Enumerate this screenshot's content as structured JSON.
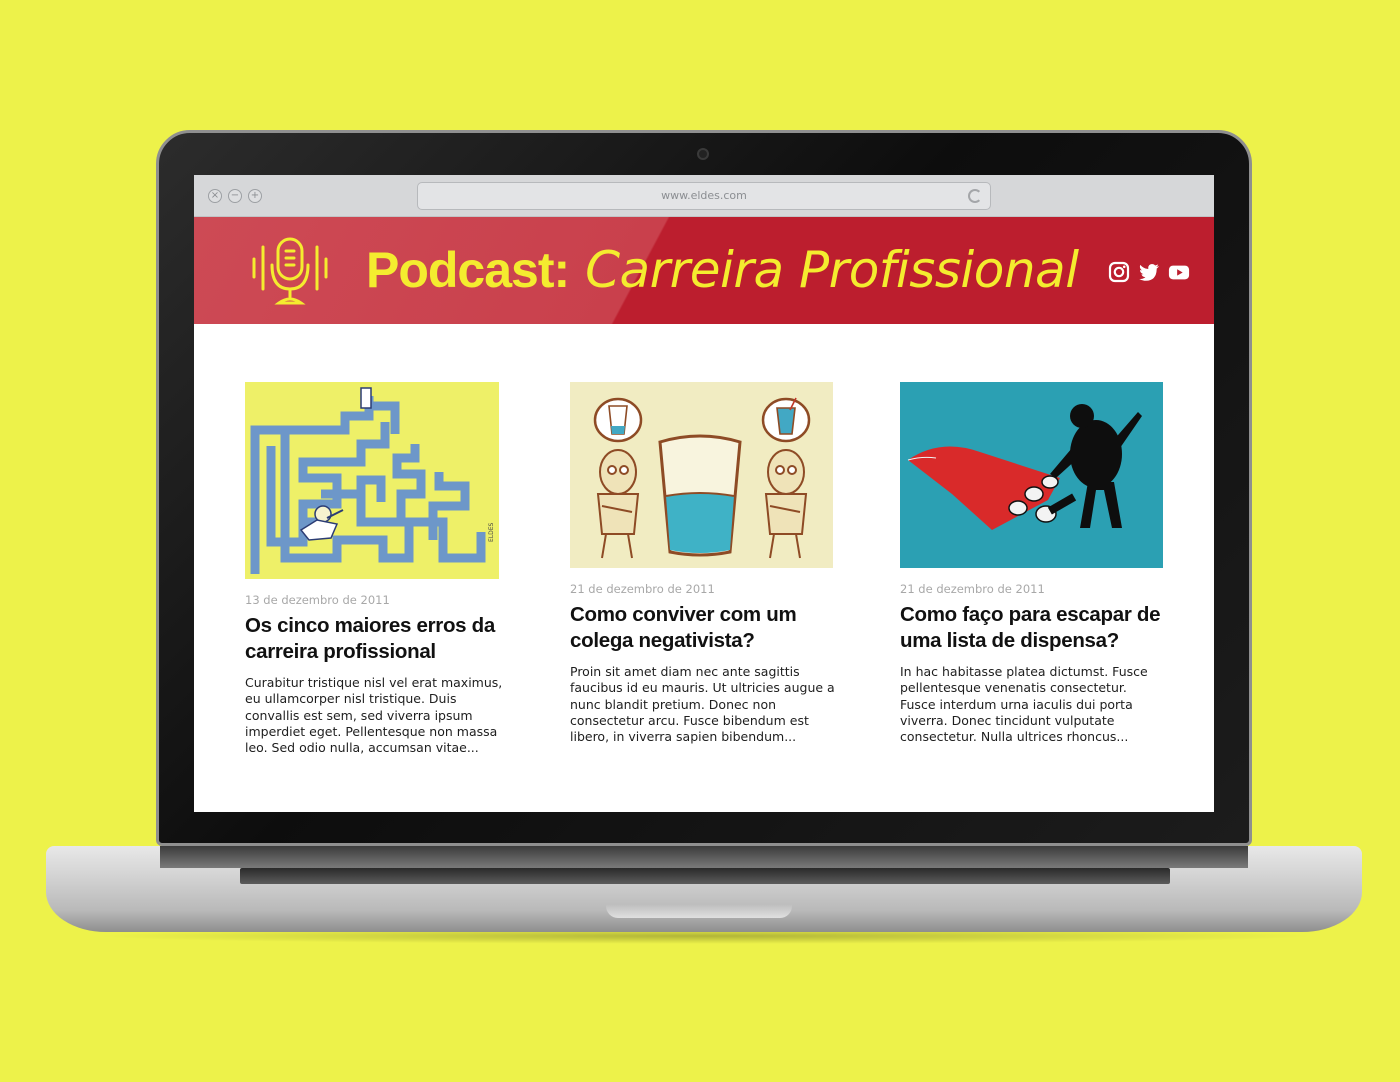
{
  "browser": {
    "url": "www.eldes.com",
    "buttons": [
      "×",
      "−",
      "+"
    ]
  },
  "header": {
    "title_strong": "Podcast:",
    "title_light": "Carreira Profissional",
    "social": [
      "instagram-icon",
      "twitter-icon",
      "youtube-icon"
    ]
  },
  "articles": [
    {
      "date": "13 de dezembro de 2011",
      "title": "Os cinco maiores erros da carreira profissional",
      "excerpt": "Curabitur tristique nisl vel erat maximus, eu ullamcorper nisl tristique. Duis convallis est sem, sed viverra ipsum imperdiet eget. Pellentesque non massa leo. Sed odio nulla, accumsan vitae..."
    },
    {
      "date": "21 de dezembro de 2011",
      "title": "Como conviver com um colega negativista?",
      "excerpt": "Proin sit amet diam nec ante sagittis faucibus id eu mauris. Ut ultricies augue a nunc blandit pretium. Donec non consectetur arcu. Fusce bibendum est libero, in viverra sapien bibendum..."
    },
    {
      "date": "21 de dezembro de 2011",
      "title": "Como faço para escapar de uma lista de dispensa?",
      "excerpt": "In hac habitasse platea dictumst. Fusce pellentesque venenatis consectetur. Fusce interdum urna iaculis dui porta viverra. Donec tincidunt vulputate consectetur. Nulla ultrices rhoncus..."
    }
  ],
  "colors": {
    "background": "#edf24a",
    "header_red": "#bc1e2e",
    "title_yellow": "#f4ec2f"
  }
}
